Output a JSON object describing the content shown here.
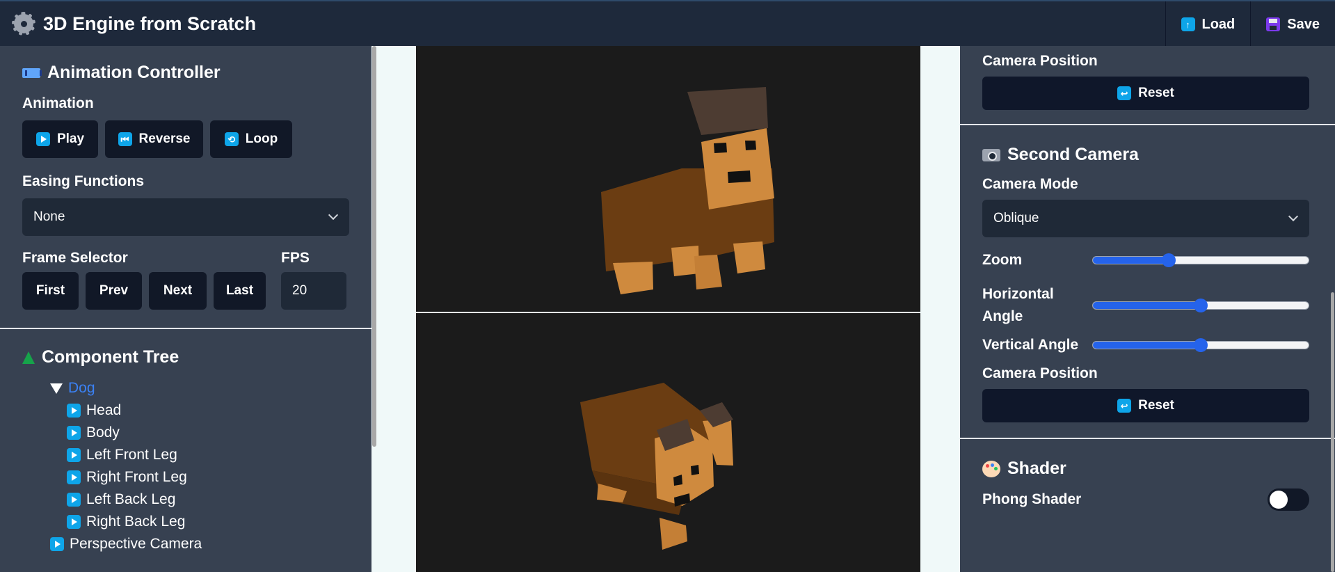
{
  "header": {
    "title": "3D Engine from Scratch",
    "load_label": "Load",
    "save_label": "Save"
  },
  "animation_controller": {
    "title": "Animation Controller",
    "animation_label": "Animation",
    "play_label": "Play",
    "reverse_label": "Reverse",
    "loop_label": "Loop",
    "easing_label": "Easing Functions",
    "easing_value": "None",
    "frame_selector_label": "Frame Selector",
    "first_label": "First",
    "prev_label": "Prev",
    "next_label": "Next",
    "last_label": "Last",
    "fps_label": "FPS",
    "fps_value": "20"
  },
  "component_tree": {
    "title": "Component Tree",
    "root": "Dog",
    "children": [
      "Head",
      "Body",
      "Left Front Leg",
      "Right Front Leg",
      "Left Back Leg",
      "Right Back Leg"
    ],
    "sibling": "Perspective Camera"
  },
  "right_panel": {
    "camera_position_label": "Camera Position",
    "reset_label": "Reset",
    "second_camera": {
      "title": "Second Camera",
      "mode_label": "Camera Mode",
      "mode_value": "Oblique",
      "zoom_label": "Zoom",
      "zoom_value": 0.35,
      "horizontal_label": "Horizontal Angle",
      "horizontal_value": 0.5,
      "vertical_label": "Vertical Angle",
      "vertical_value": 0.5,
      "camera_position_label": "Camera Position",
      "reset_label": "Reset"
    },
    "shader": {
      "title": "Shader",
      "phong_label": "Phong Shader",
      "phong_on": false
    }
  },
  "colors": {
    "header_bg": "#1e293b",
    "panel_bg": "#374151",
    "accent": "#2563eb",
    "tree_link": "#3b82f6"
  }
}
